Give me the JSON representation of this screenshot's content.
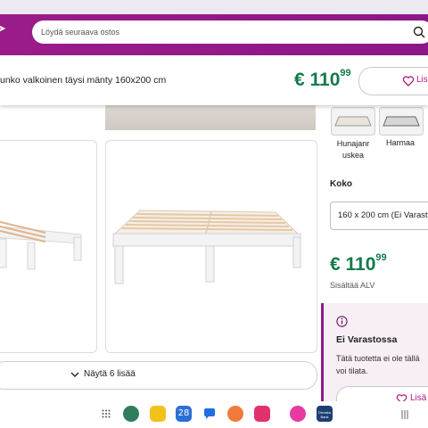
{
  "search": {
    "placeholder": "Löydä seuraava ostos"
  },
  "product": {
    "title": "unko valkoinen täysi mänty 160x200 cm",
    "price_main": "€ 110",
    "price_cents": "99",
    "add_label": "Lis"
  },
  "gallery": {
    "show_more_label": "Näytä 6 lisää"
  },
  "colors": {
    "items": [
      {
        "label": "Hunajanr uskea"
      },
      {
        "label": "Harmaa"
      }
    ]
  },
  "size": {
    "label": "Koko",
    "value": "160 x 200 cm (Ei Varast"
  },
  "pricing": {
    "main": "€ 110",
    "cents": "99",
    "vat_note": "Sisältää ALV"
  },
  "stock": {
    "title": "Ei Varastossa",
    "desc_line1": "Tätä tuotetta ei ole tällä",
    "desc_line2": "voi tilata.",
    "add_label": "Lisä"
  },
  "dock": {
    "brand_icon_text": "Denaka Bank",
    "calendar_day": "28"
  },
  "theme": {
    "brand": "#8d1a86",
    "price_green": "#137a4a"
  }
}
